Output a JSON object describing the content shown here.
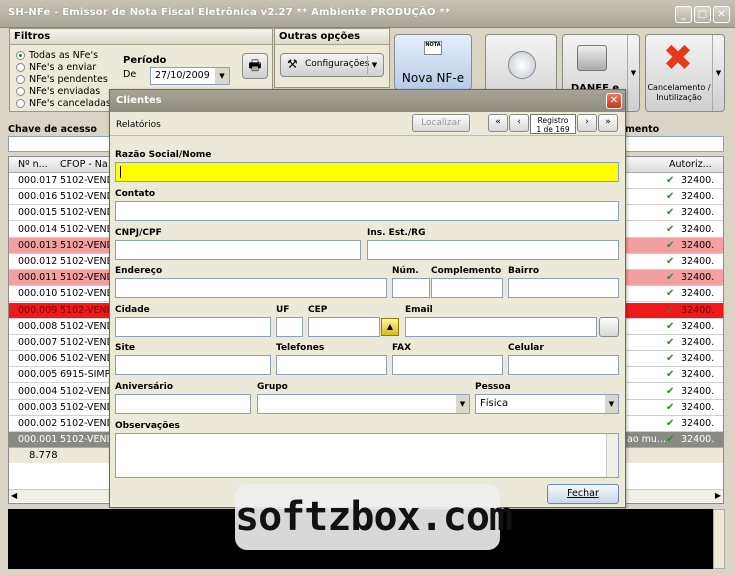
{
  "window": {
    "title": "SH-NFe - Emissor de Nota Fiscal Eletrônica v2.27  ** Ambiente PRODUÇÃO **"
  },
  "filters": {
    "title": "Filtros",
    "options": [
      "Todas as NFe's",
      "NFe's a enviar",
      "NFe's pendentes",
      "NFe's enviadas",
      "NFe's canceladas"
    ],
    "periodo_label": "Período",
    "de_label": "De",
    "date_value": "27/10/2009"
  },
  "outras": {
    "title": "Outras opções",
    "config_label": "Configurações"
  },
  "toolbar": {
    "nova_label": "Nova NF-e",
    "danfe_label": "DANFE e",
    "cancel_label": "Cancelamento / Inutilização"
  },
  "chave_label": "Chave de acesso",
  "right_col_label": "mento",
  "table": {
    "headers": {
      "num": "Nº n...",
      "cfop": "CFOP - Na",
      "autoriz": "Autoriz..."
    },
    "rows": [
      {
        "num": "000.017",
        "cfop": "5102-VEND",
        "aut": "32400.",
        "style": "normal"
      },
      {
        "num": "000.016",
        "cfop": "5102-VEND",
        "aut": "32400.",
        "style": "normal"
      },
      {
        "num": "000.015",
        "cfop": "5102-VEND",
        "aut": "32400.",
        "style": "normal"
      },
      {
        "num": "000.014",
        "cfop": "5102-VEND",
        "aut": "32400.",
        "style": "normal"
      },
      {
        "num": "000.013",
        "cfop": "5102-VEND",
        "aut": "32400.",
        "style": "pink"
      },
      {
        "num": "000.012",
        "cfop": "5102-VEND",
        "aut": "32400.",
        "style": "normal"
      },
      {
        "num": "000.011",
        "cfop": "5102-VEND",
        "aut": "32400.",
        "style": "pink"
      },
      {
        "num": "000.010",
        "cfop": "5102-VEND",
        "aut": "32400.",
        "style": "normal"
      },
      {
        "num": "000.009",
        "cfop": "5102-VEND",
        "aut": "32400.",
        "style": "red"
      },
      {
        "num": "000.008",
        "cfop": "5102-VEND",
        "aut": "32400.",
        "style": "normal"
      },
      {
        "num": "000.007",
        "cfop": "5102-VEND",
        "aut": "32400.",
        "style": "normal"
      },
      {
        "num": "000.006",
        "cfop": "5102-VEND",
        "aut": "32400.",
        "style": "normal"
      },
      {
        "num": "000.005",
        "cfop": "6915-SIMP",
        "aut": "32400.",
        "style": "normal"
      },
      {
        "num": "000.004",
        "cfop": "5102-VEND",
        "aut": "32400.",
        "style": "normal"
      },
      {
        "num": "000.003",
        "cfop": "5102-VEND",
        "aut": "32400.",
        "style": "normal"
      },
      {
        "num": "000.002",
        "cfop": "5102-VEND",
        "aut": "32400.",
        "style": "normal"
      },
      {
        "num": "000.001",
        "cfop": "5102-VEND",
        "aut": "32400.",
        "style": "selected",
        "extra": "ao mu..."
      }
    ],
    "footer_total": "8.778"
  },
  "dialog": {
    "title": "Clientes",
    "relatorios": "Relatórios",
    "localizar": "Localizar",
    "registro_line1": "Registro",
    "registro_line2": "1 de 169",
    "labels": {
      "razao": "Razão Social/Nome",
      "contato": "Contato",
      "cnpj": "CNPJ/CPF",
      "ie": "Ins. Est./RG",
      "endereco": "Endereço",
      "num": "Núm.",
      "complemento": "Complemento",
      "bairro": "Bairro",
      "cidade": "Cidade",
      "uf": "UF",
      "cep": "CEP",
      "email": "Email",
      "site": "Site",
      "telefones": "Telefones",
      "fax": "FAX",
      "celular": "Celular",
      "aniversario": "Aniversário",
      "grupo": "Grupo",
      "pessoa": "Pessoa",
      "observacoes": "Observações"
    },
    "pessoa_value": "Física",
    "fechar": "Fechar"
  },
  "watermark": "softzbox.com"
}
